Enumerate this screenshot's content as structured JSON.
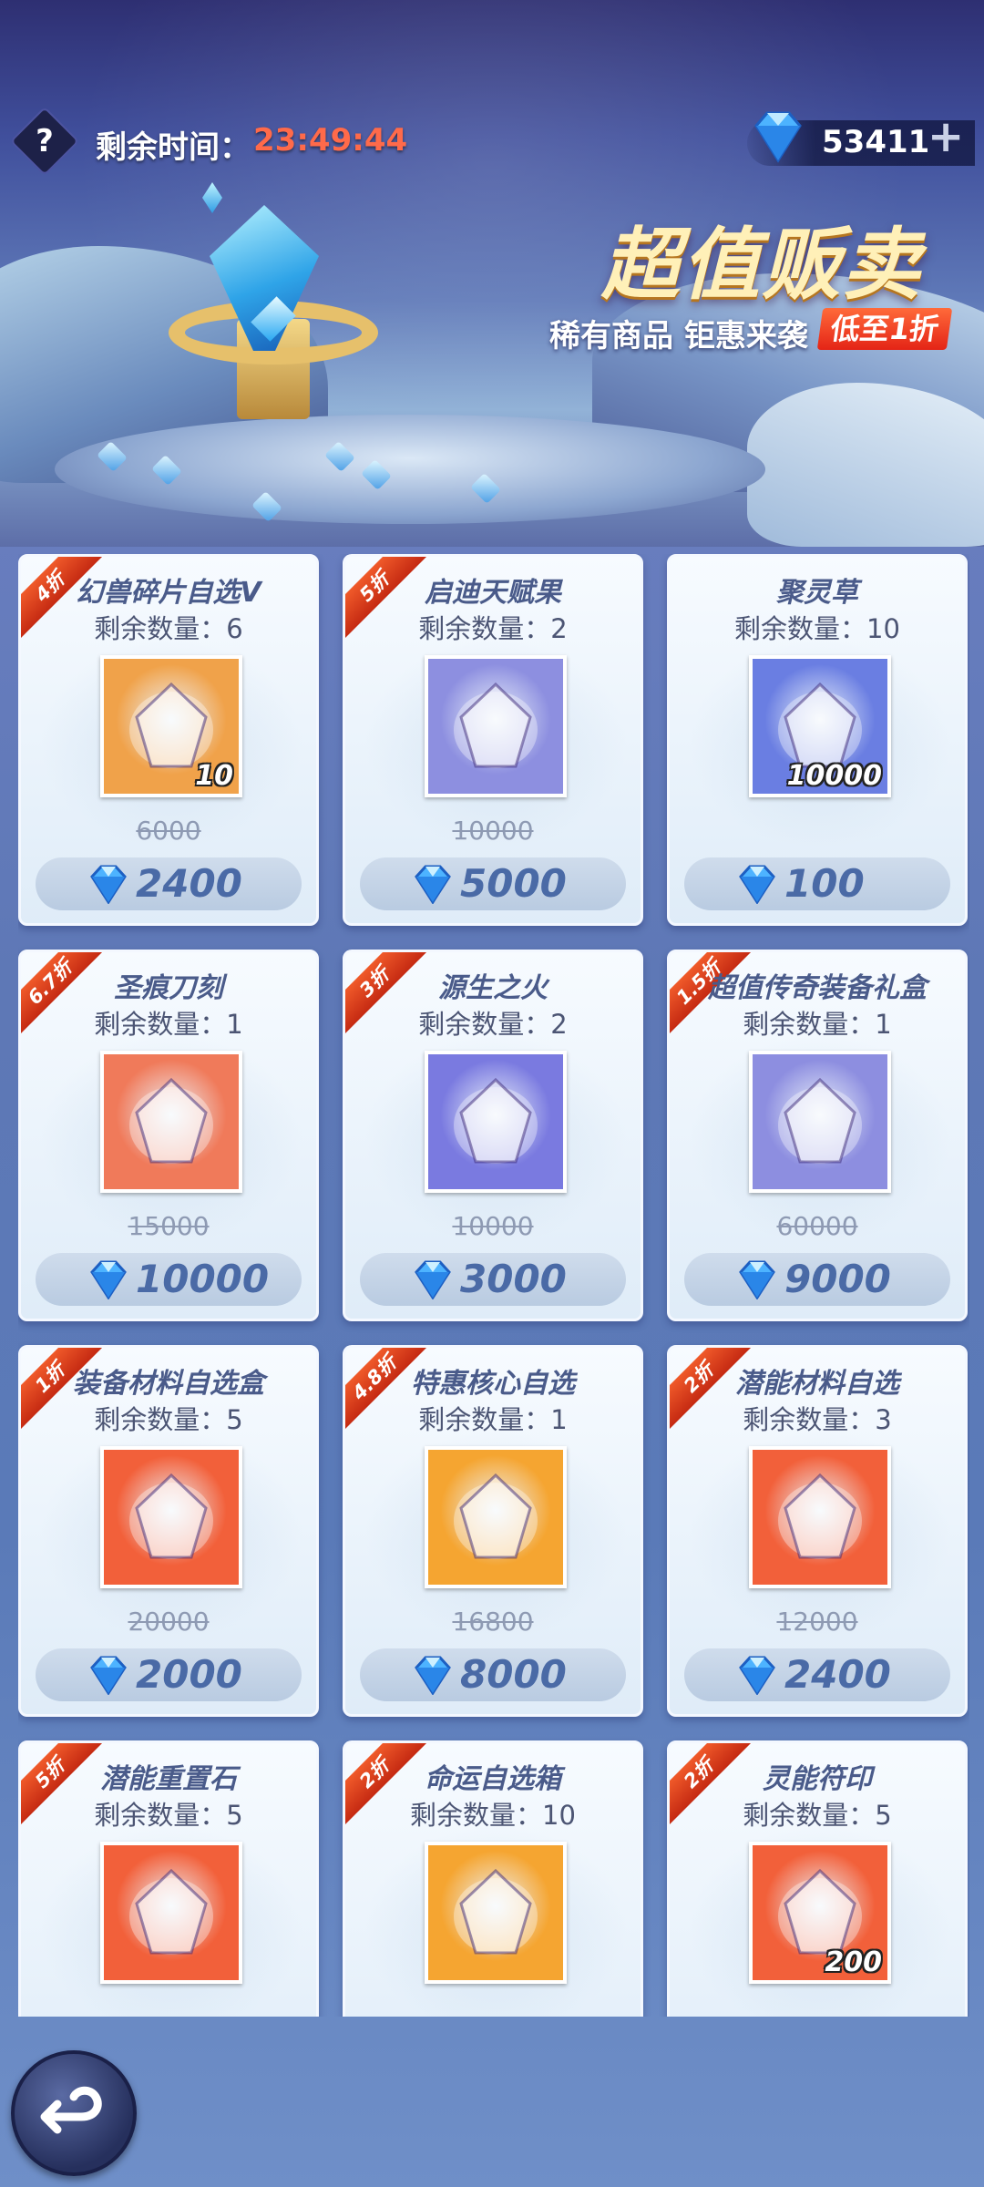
{
  "header": {
    "help_icon": "?",
    "timer_label": "剩余时间：",
    "timer_value": "23:49:44",
    "currency_value": "53411",
    "currency_add": "+"
  },
  "banner": {
    "title": "超值贩卖",
    "subtitle": "稀有商品 钜惠来袭",
    "badge": "低至1折"
  },
  "cards": [
    {
      "discount": "4折",
      "name": "幻兽碎片自选V",
      "stock": "剩余数量：6",
      "qty": "10",
      "original": "6000",
      "price": "2400",
      "icon": "golden-armor-chest-icon",
      "bg": "#f0a24a"
    },
    {
      "discount": "5折",
      "name": "启迪天赋果",
      "stock": "剩余数量：2",
      "qty": "",
      "original": "10000",
      "price": "5000",
      "icon": "talent-fruit-icon",
      "bg": "#8d8fe0"
    },
    {
      "discount": "",
      "name": "聚灵草",
      "stock": "剩余数量：10",
      "qty": "10000",
      "original": "",
      "price": "100",
      "icon": "spirit-herb-icon",
      "bg": "#6a7ee2"
    },
    {
      "discount": "6.7折",
      "name": "圣痕刀刻",
      "stock": "剩余数量：1",
      "qty": "",
      "original": "15000",
      "price": "10000",
      "icon": "holy-blade-icon",
      "bg": "#f07a5a"
    },
    {
      "discount": "3折",
      "name": "源生之火",
      "stock": "剩余数量：2",
      "qty": "",
      "original": "10000",
      "price": "3000",
      "icon": "origin-fire-icon",
      "bg": "#7a7ae0"
    },
    {
      "discount": "1.5折",
      "name": "超值传奇装备礼盒",
      "stock": "剩余数量：1",
      "qty": "",
      "original": "60000",
      "price": "9000",
      "icon": "legendary-gear-box-icon",
      "bg": "#8d8ee0"
    },
    {
      "discount": "1折",
      "name": "装备材料自选盒",
      "stock": "剩余数量：5",
      "qty": "",
      "original": "20000",
      "price": "2000",
      "icon": "gear-material-box-icon",
      "bg": "#f2603a"
    },
    {
      "discount": "4.8折",
      "name": "特惠核心自选",
      "stock": "剩余数量：1",
      "qty": "",
      "original": "16800",
      "price": "8000",
      "icon": "core-card-icon",
      "bg": "#f5a531"
    },
    {
      "discount": "2折",
      "name": "潜能材料自选",
      "stock": "剩余数量：3",
      "qty": "",
      "original": "12000",
      "price": "2400",
      "icon": "potential-chest-icon",
      "bg": "#f2603a"
    },
    {
      "discount": "5折",
      "name": "潜能重置石",
      "stock": "剩余数量：5",
      "qty": "",
      "original": "",
      "price": "",
      "icon": "reset-stone-icon",
      "bg": "#f2603a"
    },
    {
      "discount": "2折",
      "name": "命运自选箱",
      "stock": "剩余数量：10",
      "qty": "",
      "original": "",
      "price": "",
      "icon": "fate-chest-icon",
      "bg": "#f5a531"
    },
    {
      "discount": "2折",
      "name": "灵能符印",
      "stock": "剩余数量：5",
      "qty": "200",
      "original": "",
      "price": "",
      "icon": "psionic-seal-icon",
      "bg": "#f2603a"
    }
  ],
  "colors": {
    "accent_red": "#ff6a4a",
    "price_text": "#4a6aa6",
    "ribbon": "#e0401c"
  }
}
